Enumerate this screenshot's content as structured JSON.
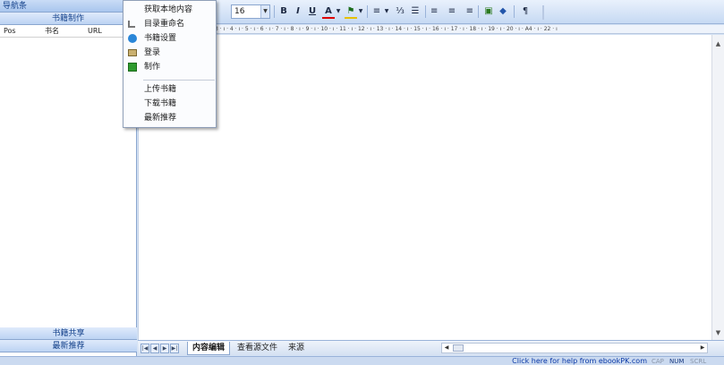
{
  "nav": {
    "title": "导航条",
    "top_band": "书籍制作",
    "columns": [
      "Pos",
      "书名",
      "URL"
    ],
    "bottom_bands": [
      "书籍共享",
      "最新推荐"
    ]
  },
  "popup_menu": {
    "items": [
      {
        "label": "获取本地内容",
        "icon": ""
      },
      {
        "label": "目录重命名",
        "icon": "rename-icon"
      },
      {
        "label": "书籍设置",
        "icon": "settings-icon"
      },
      {
        "label": "登录",
        "icon": "login-icon"
      },
      {
        "label": "制作",
        "icon": "make-icon"
      },
      {
        "label": "上传书籍",
        "icon": ""
      },
      {
        "label": "下载书籍",
        "icon": ""
      },
      {
        "label": "最新推荐",
        "icon": ""
      }
    ]
  },
  "toolbar": {
    "font_size": "16",
    "bold": "B",
    "italic": "I",
    "underline": "U",
    "font_color": "A",
    "highlight": "⚑",
    "line_spacing": "≡",
    "numbered_list": "⅓",
    "bullet_list": "☰",
    "align_left": "≡",
    "align_center": "≡",
    "align_right": "≡",
    "image": "▣",
    "link": "◆",
    "format": "¶"
  },
  "ruler": "3 · ı · 4 · ı · 5 · ı · 6 · ı · 7 · ı · 8 · ı · 9 · ı · 10 · ı · 11 · ı · 12 · ı · 13 · ı · 14 · ı · 15 · ı · 16 · ı · 17 · ı · 18 · ı · 19 · ı · 20 · ı · A4 · ı · 22 · ı",
  "tabs": [
    {
      "label": "内容编辑",
      "active": true
    },
    {
      "label": "查看源文件",
      "active": false
    },
    {
      "label": "来源",
      "active": false
    }
  ],
  "tab_nav_arrows": [
    "|◀",
    "◀",
    "▶",
    "▶|"
  ],
  "status": {
    "help_text": "Click here for help from ebookPK.com",
    "indicators": [
      "CAP",
      "NUM",
      "SCRL"
    ]
  },
  "colors": {
    "accent": "#15428b",
    "link": "#0c3aa7"
  }
}
